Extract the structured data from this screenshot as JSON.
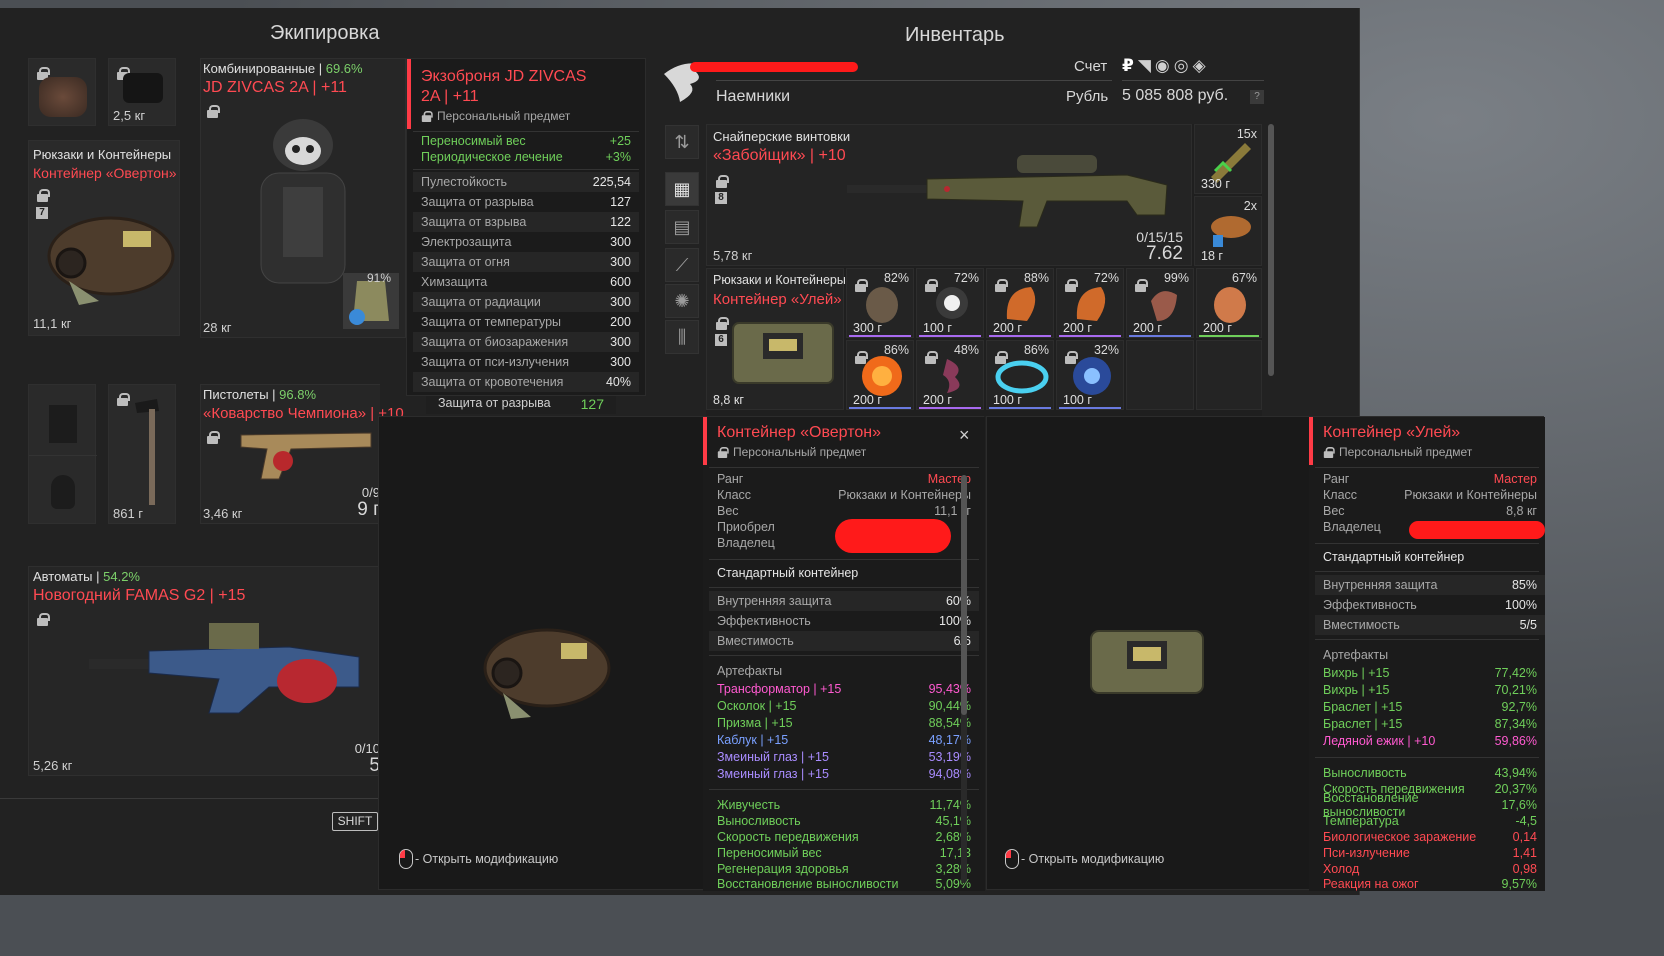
{
  "headers": {
    "equipment": "Экипировка",
    "inventory": "Инвентарь"
  },
  "equipment": {
    "slot_face_weight": "",
    "slot_nv_weight": "2,5 кг",
    "armor": {
      "category": "Комбинированные",
      "pct": "69.6%",
      "name": "JD ZIVCAS 2A | +11",
      "weight": "28 кг",
      "durability": "91%"
    },
    "backpack": {
      "category": "Рюкзаки и Контейнеры",
      "name": "Контейнер «Овертон»",
      "level": "7",
      "weight": "11,1 кг"
    },
    "melee_weight": "861 г",
    "pistol": {
      "category": "Пистолеты",
      "pct": "96.8%",
      "name": "«Коварство Чемпиона» | +10",
      "weight": "3,46 кг",
      "ammo_top": "0/9",
      "ammo_big": "9 г"
    },
    "rifle": {
      "category": "Автоматы",
      "pct": "54.2%",
      "name": "Новогодний FAMAS G2 | +15",
      "weight": "5,26 кг",
      "ammo_top": "0/10",
      "ammo_big": "5"
    },
    "shift_label": "SHIFT"
  },
  "armor_tooltip": {
    "title_line1": "Экзоброня JD ZIVCAS",
    "title_line2": "2A | +11",
    "subtitle": "Персональный предмет",
    "bonuses": [
      {
        "k": "Переносимый вес",
        "v": "+25"
      },
      {
        "k": "Периодическое лечение",
        "v": "+3%"
      }
    ],
    "stats": [
      {
        "k": "Пулестойкость",
        "v": "225,54"
      },
      {
        "k": "Защита от разрыва",
        "v": "127"
      },
      {
        "k": "Защита от взрыва",
        "v": "122"
      },
      {
        "k": "Электрозащита",
        "v": "300"
      },
      {
        "k": "Защита от огня",
        "v": "300"
      },
      {
        "k": "Химзащита",
        "v": "600"
      },
      {
        "k": "Защита от радиации",
        "v": "300"
      },
      {
        "k": "Защита от температуры",
        "v": "200"
      },
      {
        "k": "Защита от биозаражения",
        "v": "300"
      },
      {
        "k": "Защита от пси-излучения",
        "v": "300"
      },
      {
        "k": "Защита от кровотечения",
        "v": "40%"
      }
    ],
    "ghost_row": {
      "k": "Защита от разрыва",
      "v": "127"
    }
  },
  "inventory": {
    "faction": "Наемники",
    "account_label": "Счет",
    "currency_label": "Рубль",
    "currency_value": "5 085 808 руб.",
    "help": "?",
    "sniper": {
      "category": "Снайперские винтовки",
      "name": "«Забойщик» | +10",
      "level": "8",
      "weight": "5,78 кг",
      "ammo_count": "0/15/15",
      "caliber": "7.62"
    },
    "ammo_stacks": [
      {
        "count": "15x",
        "weight": "330 г"
      },
      {
        "count": "2x",
        "weight": "18 г"
      }
    ],
    "container": {
      "category": "Рюкзаки и Контейнеры",
      "name": "Контейнер «Улей»",
      "level": "6",
      "weight": "8,8 кг"
    },
    "artifacts_row1": [
      {
        "pct": "82%",
        "w": "300 г"
      },
      {
        "pct": "72%",
        "w": "100 г"
      },
      {
        "pct": "88%",
        "w": "200 г"
      },
      {
        "pct": "72%",
        "w": "200 г"
      },
      {
        "pct": "99%",
        "w": "200 г"
      },
      {
        "pct": "67%",
        "w": "200 г"
      }
    ],
    "artifacts_row2": [
      {
        "pct": "86%",
        "w": "200 г"
      },
      {
        "pct": "48%",
        "w": "200 г"
      },
      {
        "pct": "86%",
        "w": "100 г"
      },
      {
        "pct": "32%",
        "w": "100 г"
      }
    ]
  },
  "modal_overton": {
    "title": "Контейнер «Овертон»",
    "subtitle": "Персональный предмет",
    "close": "×",
    "info": [
      {
        "k": "Ранг",
        "v": "Мастер"
      },
      {
        "k": "Класс",
        "v": "Рюкзаки и Контейнеры"
      },
      {
        "k": "Вес",
        "v": "11,1 кг"
      },
      {
        "k": "Приобрел",
        "v": ""
      },
      {
        "k": "Владелец",
        "v": ""
      }
    ],
    "type": "Стандартный контейнер",
    "props": [
      {
        "k": "Внутренняя защита",
        "v": "60%"
      },
      {
        "k": "Эффективность",
        "v": "100%"
      },
      {
        "k": "Вместимость",
        "v": "6/6"
      }
    ],
    "artifacts_label": "Артефакты",
    "artifacts": [
      {
        "k": "Трансформатор | +15",
        "v": "95,43%"
      },
      {
        "k": "Осколок | +15",
        "v": "90,44%"
      },
      {
        "k": "Призма | +15",
        "v": "88,54%"
      },
      {
        "k": "Каблук | +15",
        "v": "48,17%"
      },
      {
        "k": "Змеиный глаз | +15",
        "v": "53,19%"
      },
      {
        "k": "Змеиный глаз | +15",
        "v": "94,08%"
      }
    ],
    "effects": [
      {
        "k": "Живучесть",
        "v": "11,74%"
      },
      {
        "k": "Выносливость",
        "v": "45,1%"
      },
      {
        "k": "Скорость передвижения",
        "v": "2,68%"
      },
      {
        "k": "Переносимый вес",
        "v": "17,13"
      },
      {
        "k": "Регенерация здоровья",
        "v": "3,28%"
      },
      {
        "k": "Восстановление выносливости",
        "v": "5,09%"
      }
    ],
    "hint": "- Открыть модификацию"
  },
  "modal_uley": {
    "title": "Контейнер «Улей»",
    "subtitle": "Персональный предмет",
    "info": [
      {
        "k": "Ранг",
        "v": "Мастер"
      },
      {
        "k": "Класс",
        "v": "Рюкзаки и Контейнеры"
      },
      {
        "k": "Вес",
        "v": "8,8 кг"
      },
      {
        "k": "Владелец",
        "v": ""
      }
    ],
    "type": "Стандартный контейнер",
    "props": [
      {
        "k": "Внутренняя защита",
        "v": "85%"
      },
      {
        "k": "Эффективность",
        "v": "100%"
      },
      {
        "k": "Вместимость",
        "v": "5/5"
      }
    ],
    "artifacts_label": "Артефакты",
    "artifacts": [
      {
        "k": "Вихрь | +15",
        "v": "77,42%"
      },
      {
        "k": "Вихрь | +15",
        "v": "70,21%"
      },
      {
        "k": "Браслет | +15",
        "v": "92,7%"
      },
      {
        "k": "Браслет | +15",
        "v": "87,34%"
      },
      {
        "k": "Ледяной ежик | +10",
        "v": "59,86%"
      }
    ],
    "effects": [
      {
        "k": "Выносливость",
        "v": "43,94%"
      },
      {
        "k": "Скорость передвижения",
        "v": "20,37%"
      },
      {
        "k": "Восстановление выносливости",
        "v": "17,6%"
      },
      {
        "k": "Температура",
        "v": "-4,5"
      },
      {
        "k": "Биологическое заражение",
        "v": "0,14"
      },
      {
        "k": "Пси-излучение",
        "v": "1,41"
      },
      {
        "k": "Холод",
        "v": "0,98"
      },
      {
        "k": "Реакция на ожог",
        "v": "9,57%"
      }
    ],
    "hint": "- Открыть модификацию"
  },
  "colors": {
    "accent_red": "#ff3b46",
    "positive_green": "#6fcf5a",
    "panel_bg": "#222222"
  }
}
